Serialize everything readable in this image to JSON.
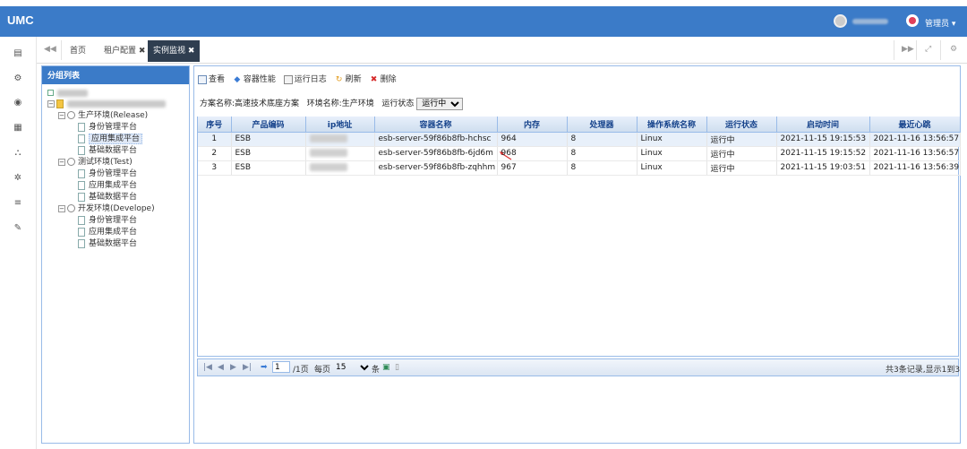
{
  "app": {
    "logo": "UMC",
    "admin_label": "管理员 ▾"
  },
  "tabs": [
    {
      "label": "首页"
    },
    {
      "label": "租户配置 ✖"
    },
    {
      "label": "实例监视 ✖"
    }
  ],
  "tab_controls": {
    "prev": "◀◀",
    "next": "▶▶",
    "expand": "⤢",
    "settings": "⚙"
  },
  "sidebar_icons": [
    "profile-card-icon",
    "gears-icon",
    "eye-icon",
    "grid-icon",
    "sitemap-icon",
    "gear-icon",
    "list-icon",
    "wrench-icon"
  ],
  "left_panel": {
    "title": "分组列表",
    "tree": {
      "env1": "生产环境(Release)",
      "env1_items": [
        "身份管理平台",
        "应用集成平台",
        "基础数据平台"
      ],
      "env2": "测试环境(Test)",
      "env2_items": [
        "身份管理平台",
        "应用集成平台",
        "基础数据平台"
      ],
      "env3": "开发环境(Develope)",
      "env3_items": [
        "身份管理平台",
        "应用集成平台",
        "基础数据平台"
      ]
    }
  },
  "toolbar": {
    "view": "查看",
    "perf": "容器性能",
    "log": "运行日志",
    "refresh": "刷新",
    "delete": "删除"
  },
  "filters": {
    "plan_label": "方案名称:",
    "plan_value": "高速技术底座方案",
    "env_label": "环境名称:",
    "env_value": "生产环境",
    "status_label": "运行状态",
    "status_value": "运行中"
  },
  "table": {
    "columns": [
      "序号",
      "产品编码",
      "ip地址",
      "容器名称",
      "内存",
      "处理器",
      "操作系统名称",
      "运行状态",
      "启动时间",
      "最近心跳"
    ],
    "rows": [
      [
        "1",
        "ESB",
        "",
        "esb-server-59f86b8fb-hchsc",
        "964",
        "8",
        "Linux",
        "运行中",
        "2021-11-15 19:15:53",
        "2021-11-16 13:56:57"
      ],
      [
        "2",
        "ESB",
        "",
        "esb-server-59f86b8fb-6jd6m",
        "968",
        "8",
        "Linux",
        "运行中",
        "2021-11-15 19:15:52",
        "2021-11-16 13:56:57"
      ],
      [
        "3",
        "ESB",
        "",
        "esb-server-59f86b8fb-zqhhm",
        "967",
        "8",
        "Linux",
        "运行中",
        "2021-11-15 19:03:51",
        "2021-11-16 13:56:39"
      ]
    ]
  },
  "pager": {
    "page_value": "1",
    "total_pages": "/1页",
    "per_page_label": "每页",
    "per_page_value": "15",
    "unit": "条",
    "summary": "共3条记录,显示1到3"
  }
}
